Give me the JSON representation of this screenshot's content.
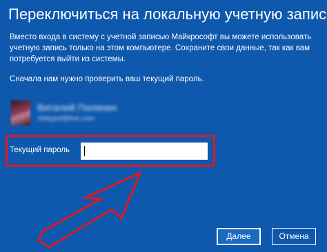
{
  "dialog": {
    "title": "Переключиться на локальную учетную запись",
    "description": "Вместо входа в систему с учетной записью Майкрософт вы можете использовать учетную запись только на этом компьютере. Сохраните свои данные, так как вам потребуется выйти из системы.",
    "note": "Сначала нам нужно проверить ваш текущий пароль."
  },
  "account": {
    "name": "Виталий Полянин",
    "email": "vitalypol@live.com"
  },
  "password": {
    "label": "Текущий пароль",
    "value": ""
  },
  "buttons": {
    "next": "Далее",
    "cancel": "Отмена"
  },
  "colors": {
    "background": "#0e58ae",
    "highlight_frame": "#e0181e",
    "annotation_arrow": "#e0181e"
  }
}
